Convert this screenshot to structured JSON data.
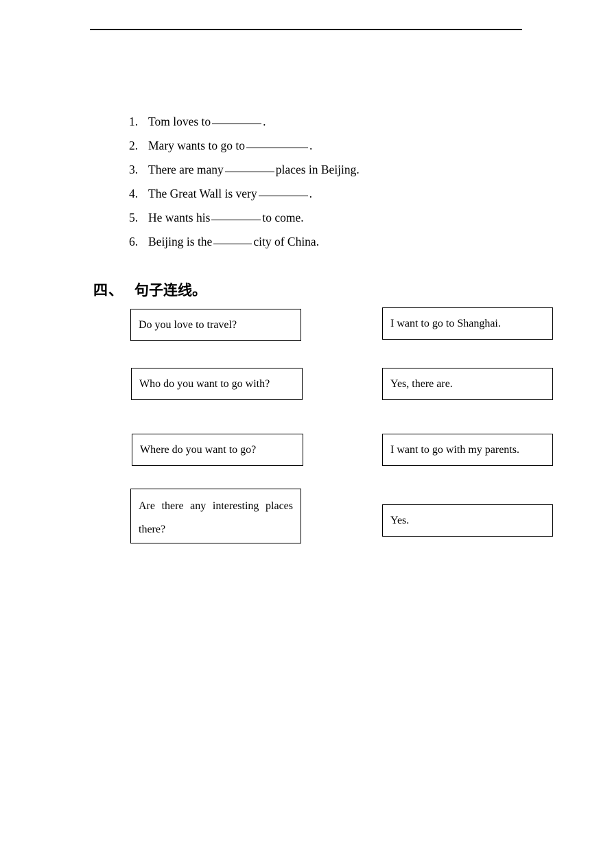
{
  "document": {
    "top_rule": true
  },
  "fill_in_blanks": {
    "items": [
      {
        "num": "1.",
        "before": "Tom loves to",
        "blank": "9",
        "after": "."
      },
      {
        "num": "2.",
        "before": "Mary wants to go to",
        "blank": "11",
        "after": "."
      },
      {
        "num": "3.",
        "before": "There are many",
        "blank": "9",
        "after": "places in Beijing."
      },
      {
        "num": "4.",
        "before": "The Great Wall is very",
        "blank": "9",
        "after": "."
      },
      {
        "num": "5.",
        "before": "He wants his",
        "blank": "9",
        "after": "to come."
      },
      {
        "num": "6.",
        "before": "Beijing is the",
        "blank": "7",
        "after": "city of China."
      }
    ]
  },
  "section": {
    "number": "四、",
    "title": "句子连线。"
  },
  "matching": {
    "left": [
      {
        "text": "Do you love to travel?"
      },
      {
        "text": "Who do you want to go with?"
      },
      {
        "text": "Where do you want to go?"
      },
      {
        "line1": "Are there any interesting places",
        "line2": "there?"
      }
    ],
    "right": [
      {
        "text": "I want to go to Shanghai."
      },
      {
        "text": "Yes, there are."
      },
      {
        "text": "I want to go with my parents."
      },
      {
        "text": "Yes."
      }
    ]
  }
}
